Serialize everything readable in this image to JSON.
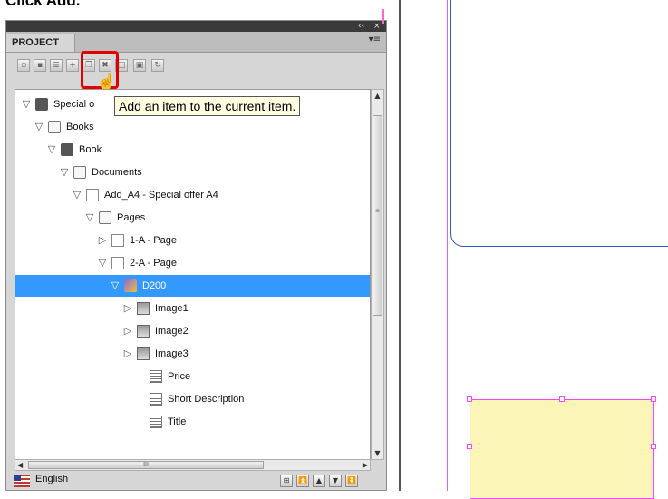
{
  "heading": "Click Add.",
  "panel": {
    "title": "PROJECT",
    "collapse_glyph": "‹‹",
    "close_glyph": "×",
    "menu_glyph": "▾≡",
    "toolbar": [
      {
        "name": "open-icon",
        "glyph": "▫"
      },
      {
        "name": "save-icon",
        "glyph": "▪"
      },
      {
        "name": "properties-icon",
        "glyph": "≣"
      },
      {
        "name": "add-item-icon",
        "glyph": "+"
      },
      {
        "name": "copy-icon",
        "glyph": "❐"
      },
      {
        "name": "delete-icon",
        "glyph": "✖"
      },
      {
        "name": "new-page-icon",
        "glyph": "□"
      },
      {
        "name": "preview-icon",
        "glyph": "▣"
      },
      {
        "name": "refresh-icon",
        "glyph": "↻"
      }
    ],
    "tooltip": "Add an item to the current item.",
    "tree": [
      {
        "label": "Special o",
        "icon": "book",
        "twisty": "▽"
      },
      {
        "label": "Books",
        "icon": "folder",
        "twisty": "▽"
      },
      {
        "label": "Book",
        "icon": "book",
        "twisty": "▽"
      },
      {
        "label": "Documents",
        "icon": "folder",
        "twisty": "▽"
      },
      {
        "label": "Add_A4 - Special offer A4",
        "icon": "doc",
        "twisty": "▽"
      },
      {
        "label": "Pages",
        "icon": "folder",
        "twisty": "▽"
      },
      {
        "label": "1-A - Page",
        "icon": "page",
        "twisty": "▷"
      },
      {
        "label": "2-A - Page",
        "icon": "page",
        "twisty": "▽"
      },
      {
        "label": "D200",
        "icon": "group",
        "twisty": "▽",
        "selected": true
      },
      {
        "label": "Image1",
        "icon": "image",
        "twisty": "▷"
      },
      {
        "label": "Image2",
        "icon": "image",
        "twisty": "▷"
      },
      {
        "label": "Image3",
        "icon": "image",
        "twisty": "▷"
      },
      {
        "label": "Price",
        "icon": "text",
        "twisty": ""
      },
      {
        "label": "Short Description",
        "icon": "text",
        "twisty": ""
      },
      {
        "label": "Title",
        "icon": "text",
        "twisty": ""
      }
    ],
    "scroll_glyphs": {
      "up": "▲",
      "down": "▼",
      "left": "◀",
      "right": "▶",
      "grip": "≡",
      "hgrip": "III"
    },
    "language": "English",
    "bottom_buttons": [
      {
        "name": "expand-all-icon",
        "glyph": "⊞"
      },
      {
        "name": "move-top-icon",
        "glyph": "⏫"
      },
      {
        "name": "move-up-icon",
        "glyph": "▲"
      },
      {
        "name": "move-down-icon",
        "glyph": "▼"
      },
      {
        "name": "move-bottom-icon",
        "glyph": "⏬"
      }
    ]
  },
  "colors": {
    "selection": "#3399ff",
    "highlight": "#e00000",
    "tooltip_bg": "#ffffe1",
    "frame_pink": "#ff44ff",
    "frame_blue": "#3355cc",
    "frame_fill": "#fbf5b7"
  }
}
